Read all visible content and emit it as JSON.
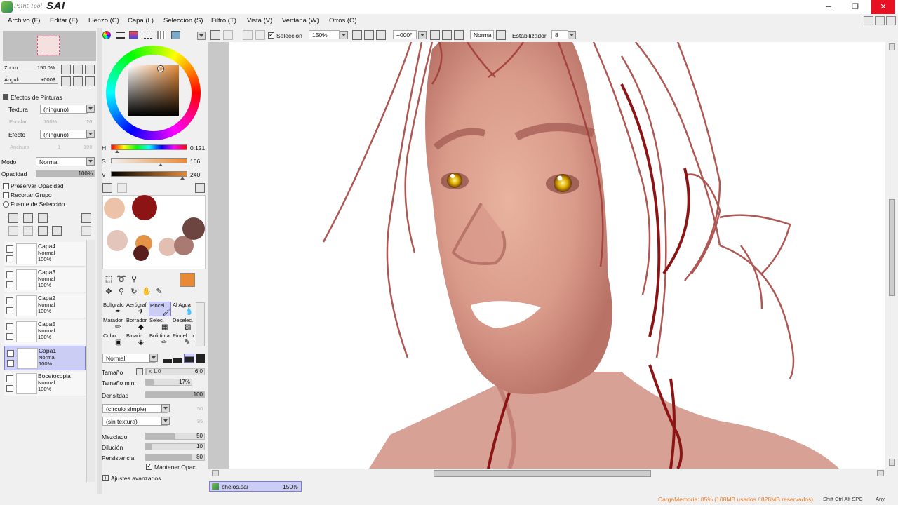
{
  "app": {
    "brand_small": "Paint Tool",
    "brand_big": "SAI"
  },
  "window": {
    "minimize": "─",
    "maximize": "❐",
    "close": "✕"
  },
  "menu": [
    "Archivo (F)",
    "Editar (E)",
    "Lienzo (C)",
    "Capa (L)",
    "Selección (S)",
    "Filtro (T)",
    "Vista (V)",
    "Ventana (W)",
    "Otros (O)"
  ],
  "navigator": {
    "zoom_label": "Zoom",
    "zoom_value": "150.0%",
    "angle_label": "Ángulo",
    "angle_value": "+000$"
  },
  "effects": {
    "header": "Efectos de Pinturas",
    "texture_label": "Textura",
    "texture_value": "(ninguno)",
    "scale_label": "Escalar",
    "scale_value": "100%",
    "scale_num": "20",
    "effect_label": "Efecto",
    "effect_value": "(ninguno)",
    "width_label": "Anchura",
    "width_value": "1",
    "width_num": "100"
  },
  "layer_props": {
    "mode_label": "Modo",
    "mode_value": "Normal",
    "opacity_label": "Opacidad",
    "opacity_value": "100%",
    "preserve_opacity": "Preservar Opacidad",
    "clip_group": "Recortar Grupo",
    "selection_source": "Fuente de Selección"
  },
  "layers": [
    {
      "name": "Capa4",
      "mode": "Normal",
      "opacity": "100%",
      "selected": false
    },
    {
      "name": "Capa3",
      "mode": "Normal",
      "opacity": "100%",
      "selected": false
    },
    {
      "name": "Capa2",
      "mode": "Normal",
      "opacity": "100%",
      "selected": false
    },
    {
      "name": "Capa5",
      "mode": "Normal",
      "opacity": "100%",
      "selected": false
    },
    {
      "name": "Capa1",
      "mode": "Normal",
      "opacity": "100%",
      "selected": true
    },
    {
      "name": "Bocetocopia",
      "mode": "Normal",
      "opacity": "100%",
      "selected": false
    }
  ],
  "color": {
    "h_label": "H",
    "h_value": "0:121",
    "s_label": "S",
    "s_value": "166",
    "v_label": "V",
    "v_value": "240",
    "h_fraction": 0.08,
    "s_fraction": 0.65,
    "v_fraction": 0.94,
    "current": "#e88a35",
    "swatches": [
      "#ecc3a8",
      "#8c1414",
      "#e3c5bb",
      "#e59447",
      "#e2bfb0",
      "#a87a72",
      "#6d4540",
      "#5a1e1e"
    ]
  },
  "tools": {
    "brushes": [
      {
        "label": "Bolígrafc",
        "icon": "pen-icon"
      },
      {
        "label": "Aerógraf",
        "icon": "airbrush-icon"
      },
      {
        "label": "Pincel",
        "icon": "brush-icon",
        "selected": true
      },
      {
        "label": "Al Agua",
        "icon": "watercolor-icon"
      },
      {
        "label": "Marador",
        "icon": "marker-icon"
      },
      {
        "label": "Borrador",
        "icon": "eraser-icon"
      },
      {
        "label": "Selec.",
        "icon": "select-pen-icon"
      },
      {
        "label": "Deselec.",
        "icon": "deselect-pen-icon"
      },
      {
        "label": "Cubo",
        "icon": "bucket-icon"
      },
      {
        "label": "Binario",
        "icon": "binary-icon"
      },
      {
        "label": "Boli tinta",
        "icon": "ink-pen-icon"
      },
      {
        "label": "Pincel Lir",
        "icon": "line-brush-icon"
      }
    ],
    "blend_mode": "Normal",
    "size_label": "Tamaño",
    "size_mult": "x 1.0",
    "size_value": "6.0",
    "min_size_label": "Tamaño min.",
    "min_size_value": "17%",
    "min_size_fraction": 0.17,
    "density_label": "Densitdad",
    "density_value": "100",
    "shape_value": "(círculo simple)",
    "shape_num": "50",
    "texture_value": "(sin textura)",
    "texture_num": "95",
    "blend_label": "Mezclado",
    "blend_value": "50",
    "blend_fraction": 0.5,
    "dilution_label": "Dilución",
    "dilution_value": "10",
    "dilution_fraction": 0.1,
    "persistence_label": "Persistencia",
    "persistence_value": "80",
    "persistence_fraction": 0.8,
    "keep_opacity": "Mantener Opac.",
    "advanced": "Ajustes avanzados"
  },
  "toolbar": {
    "selection_label": "Selección",
    "zoom_value": "150%",
    "angle_value": "+000°",
    "mode_value": "Normal",
    "stabilizer_label": "Estabilizador",
    "stabilizer_value": "8"
  },
  "document_tab": {
    "name": "chelos.sai",
    "zoom": "150%"
  },
  "status": {
    "memory": "CargaMemoria: 85% (108MB usados / 828MB reservados)",
    "keys": "Shift Ctrl Alt SPC",
    "any": "Any"
  }
}
